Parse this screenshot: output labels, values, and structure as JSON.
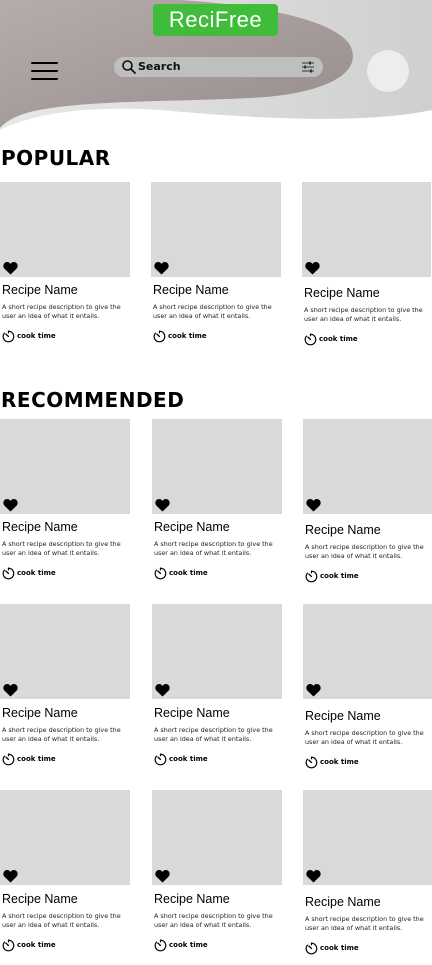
{
  "header": {
    "app_name": "ReciFree",
    "search_placeholder": "Search",
    "colors": {
      "brand": "#3fbd3a",
      "wave_dark": "#a29898",
      "wave_light": "#d6d6d6"
    }
  },
  "popular": {
    "title": "POPULAR",
    "cards": [
      {
        "name": "Recipe Name",
        "description": "A short recipe description to give the user an idea of what it entails.",
        "cook_time": "cook time"
      },
      {
        "name": "Recipe Name",
        "description": "A short recipe description to give the user an idea of what it entails.",
        "cook_time": "cook time"
      },
      {
        "name": "Recipe Name",
        "description": "A short recipe description to give the user an idea of what it entails.",
        "cook_time": "cook time"
      }
    ]
  },
  "recommended": {
    "title": "RECOMMENDED",
    "cards": [
      {
        "name": "Recipe Name",
        "description": "A short recipe description to give the user an idea of what it entails.",
        "cook_time": "cook time"
      },
      {
        "name": "Recipe Name",
        "description": "A short recipe description to give the user an idea of what it entails.",
        "cook_time": "cook time"
      },
      {
        "name": "Recipe Name",
        "description": "A short recipe description to give the user an idea of what it entails.",
        "cook_time": "cook time"
      },
      {
        "name": "Recipe Name",
        "description": "A short recipe description to give the user an idea of what it entails.",
        "cook_time": "cook time"
      },
      {
        "name": "Recipe Name",
        "description": "A short recipe description to give the user an idea of what it entails.",
        "cook_time": "cook time"
      },
      {
        "name": "Recipe Name",
        "description": "A short recipe description to give the user an idea of what it entails.",
        "cook_time": "cook time"
      },
      {
        "name": "Recipe Name",
        "description": "A short recipe description to give the user an idea of what it entails.",
        "cook_time": "cook time"
      },
      {
        "name": "Recipe Name",
        "description": "A short recipe description to give the user an idea of what it entails.",
        "cook_time": "cook time"
      },
      {
        "name": "Recipe Name",
        "description": "A short recipe description to give the user an idea of what it entails.",
        "cook_time": "cook time"
      }
    ]
  }
}
